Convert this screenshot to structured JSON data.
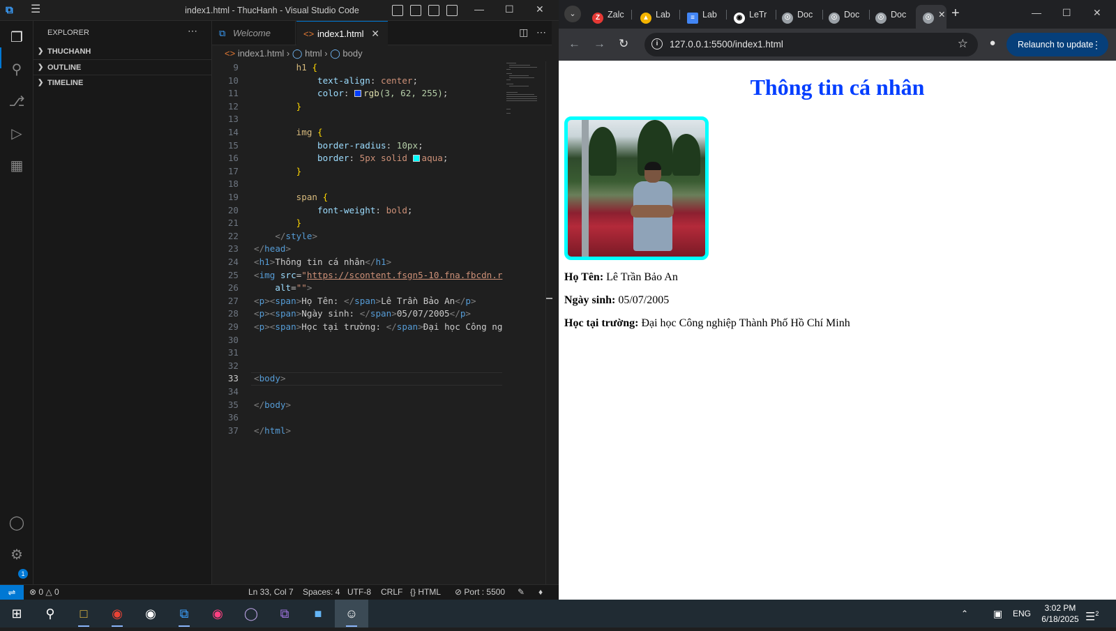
{
  "vscode": {
    "window_title": "index1.html - ThucHanh - Visual Studio Code",
    "explorer_label": "EXPLORER",
    "sections": [
      "THUCHANH",
      "OUTLINE",
      "TIMELINE"
    ],
    "tabs": [
      {
        "label": "Welcome"
      },
      {
        "label": "index1.html"
      }
    ],
    "breadcrumb": [
      "index1.html",
      "html",
      "body"
    ],
    "code_lines": [
      {
        "n": "9"
      },
      {
        "n": "10"
      },
      {
        "n": "11"
      },
      {
        "n": "12"
      },
      {
        "n": "13"
      },
      {
        "n": "14"
      },
      {
        "n": "15"
      },
      {
        "n": "16"
      },
      {
        "n": "17"
      },
      {
        "n": "18"
      },
      {
        "n": "19"
      },
      {
        "n": "20"
      },
      {
        "n": "21"
      },
      {
        "n": "22"
      },
      {
        "n": "23"
      },
      {
        "n": "24"
      },
      {
        "n": "25"
      },
      {
        "n": "26"
      },
      {
        "n": "27"
      },
      {
        "n": "28"
      },
      {
        "n": "29"
      },
      {
        "n": "30"
      },
      {
        "n": "31"
      },
      {
        "n": "32"
      },
      {
        "n": "33"
      },
      {
        "n": "34"
      },
      {
        "n": "35"
      },
      {
        "n": "36"
      },
      {
        "n": "37"
      }
    ],
    "code": {
      "l9_sel": "h1",
      "l9_brace": "{",
      "l10_prop": "text-align",
      "l10_val": "center",
      "l11_prop": "color",
      "l11_fn": "rgb",
      "l11_args": "(3, 62, 255)",
      "l12_brace": "}",
      "l14_sel": "img",
      "l14_brace": "{",
      "l15_prop": "border-radius",
      "l15_val": "10px",
      "l16_prop": "border",
      "l16_val": "5px solid",
      "l16_color": "aqua",
      "l17_brace": "}",
      "l19_sel": "span",
      "l19_brace": "{",
      "l20_prop": "font-weight",
      "l20_val": "bold",
      "l21_brace": "}",
      "l22_tag": "style",
      "l23_tag": "head",
      "l24_tag": "h1",
      "l24_text": "Thông tin cá nhân",
      "l25_tag": "img",
      "l25_attr": "src",
      "l25_url": "https://scontent.fsgn5-10.fna.fbcdn.r",
      "l26_attr": "alt",
      "l26_val": "\"\"",
      "l27_label": "Họ Tên: ",
      "l27_text": "Lê Trần Bảo An",
      "l28_label": "Ngày sinh: ",
      "l28_text": "05/07/2005",
      "l29_label": "Học tại trường: ",
      "l29_text": "Đại học Công ng",
      "l33_tag": "body",
      "l35_tag": "body",
      "l37_tag": "html"
    },
    "status": {
      "errors": "0",
      "warnings": "0",
      "cursor": "Ln 33, Col 7",
      "spaces": "Spaces: 4",
      "encoding": "UTF-8",
      "eol": "CRLF",
      "language": "HTML",
      "port": "Port : 5500"
    },
    "settings_badge": "1",
    "accent": "#0078d4"
  },
  "browser": {
    "tabs": [
      {
        "label": "Zalc",
        "icon": "zalo-icon"
      },
      {
        "label": "Lab",
        "icon": "drive-icon"
      },
      {
        "label": "Lab",
        "icon": "docs-icon"
      },
      {
        "label": "LeTr",
        "icon": "github-icon"
      },
      {
        "label": "Doc",
        "icon": "globe-icon"
      },
      {
        "label": "Doc",
        "icon": "globe-icon"
      },
      {
        "label": "Doc",
        "icon": "globe-icon"
      }
    ],
    "url": "127.0.0.1:5500/index1.html",
    "relaunch_label": "Relaunch to update",
    "page": {
      "title": "Thông tin cá nhân",
      "title_color": "#033eff",
      "photo_border_color": "aqua",
      "name_label": "Họ Tên:",
      "name_value": "Lê Trần Bảo An",
      "dob_label": "Ngày sinh:",
      "dob_value": "05/07/2005",
      "school_label": "Học tại trường:",
      "school_value": "Đại học Công nghiệp Thành Phố Hồ Chí Minh"
    }
  },
  "taskbar": {
    "apps": [
      "windows-start-icon",
      "search-icon",
      "file-explorer-icon",
      "chrome-icon",
      "app-icon",
      "vscode-icon",
      "app-icon",
      "eclipse-icon",
      "visual-studio-icon",
      "app-icon",
      "photos-icon"
    ],
    "language": "ENG",
    "time": "3:02 PM",
    "date": "6/18/2025",
    "notification_count": "2"
  }
}
